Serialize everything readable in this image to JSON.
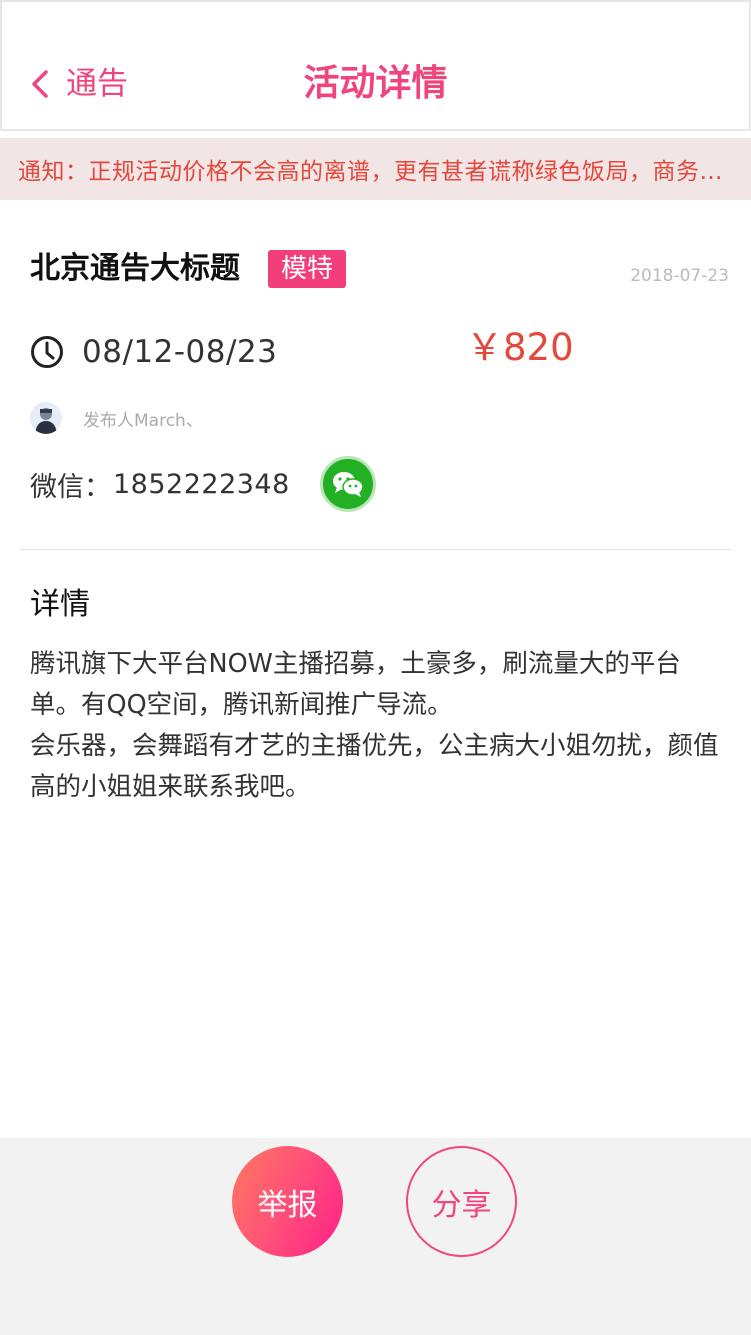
{
  "header": {
    "back_label": "通告",
    "title": "活动详情"
  },
  "notice": {
    "text": "通知：正规活动价格不会高的离谱，更有甚者谎称绿色饭局，商务…"
  },
  "post": {
    "title": "北京通告大标题",
    "tag": "模特",
    "date": "2018-07-23",
    "date_range": "08/12-08/23",
    "price": "￥820",
    "publisher": "发布人March、",
    "wechat_label": "微信：",
    "wechat_value": "1852222348"
  },
  "details": {
    "heading": "详情",
    "paragraphs": [
      "腾讯旗下大平台NOW主播招募，土豪多，刷流量大的平台单。有QQ空间，腾讯新闻推广导流。",
      "会乐器，会舞蹈有才艺的主播优先，公主病大小姐勿扰，颜值高的小姐姐来联系我吧。"
    ]
  },
  "actions": {
    "report_label": "举报",
    "share_label": "分享"
  },
  "colors": {
    "accent": "#f0457c",
    "price": "#e5473b",
    "notice_bg": "#f1e6e5",
    "wechat": "#23b024"
  },
  "icons": {
    "back": "chevron-left-icon",
    "clock": "clock-icon",
    "wechat": "wechat-icon"
  }
}
